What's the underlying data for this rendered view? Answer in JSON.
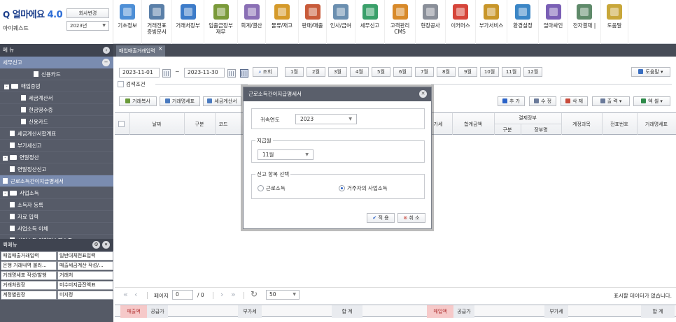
{
  "brand": {
    "logo": "얼마에요",
    "version": "4.0",
    "company": "아이퀘스트",
    "company_change": "회사변경",
    "year": "2023년"
  },
  "menu": [
    {
      "label": "기초정보",
      "color": "#4e8fd6"
    },
    {
      "label": "거래전표\n증빙문서",
      "color": "#5a7fa8"
    },
    {
      "label": "거래처장부",
      "color": "#3d7cc9"
    },
    {
      "label": "입출금장부\n재무",
      "color": "#7a9a3a"
    },
    {
      "label": "회계/결산",
      "color": "#8a6fb5"
    },
    {
      "label": "물류/재고",
      "color": "#d59a2a"
    },
    {
      "label": "판매/매출",
      "color": "#c85b3a"
    },
    {
      "label": "인사/급여",
      "color": "#6b8fb0"
    },
    {
      "label": "세무신고",
      "color": "#3aa06a"
    },
    {
      "label": "고객관리\nCMS",
      "color": "#d88a2a"
    },
    {
      "label": "현장공사",
      "color": "#8a8f99"
    },
    {
      "label": "이커머스",
      "color": "#d6453a"
    },
    {
      "label": "부가서비스",
      "color": "#c8962a"
    },
    {
      "label": "환경설정",
      "color": "#3b86c6"
    },
    {
      "label": "얼마싸인",
      "color": "#7a5fb5"
    },
    {
      "label": "전자결재 |",
      "color": "#5f8a6a"
    },
    {
      "label": "도움말",
      "color": "#c8a73a"
    }
  ],
  "sidebar": {
    "menu_title": "메 뉴",
    "section": "세무신고",
    "items": [
      {
        "label": "신용카드",
        "indent": 48,
        "kind": "file",
        "active": false
      },
      {
        "label": "매입증빙",
        "indent": 6,
        "kind": "folder",
        "toggle": "-",
        "active": false
      },
      {
        "label": "세금계산서",
        "indent": 30,
        "kind": "file",
        "active": false
      },
      {
        "label": "현금영수증",
        "indent": 30,
        "kind": "file",
        "active": false
      },
      {
        "label": "신용카드",
        "indent": 30,
        "kind": "file",
        "active": false
      },
      {
        "label": "세금계산서합계표",
        "indent": 14,
        "kind": "file",
        "active": false
      },
      {
        "label": "부가세신고",
        "indent": 14,
        "kind": "file",
        "active": false
      },
      {
        "label": "연말정산",
        "indent": 4,
        "kind": "folder",
        "toggle": "-",
        "active": false
      },
      {
        "label": "연말정산신고",
        "indent": 14,
        "kind": "file",
        "active": false
      },
      {
        "label": "근로소득간이지급명세서",
        "indent": 4,
        "kind": "file",
        "active": true
      },
      {
        "label": "사업소득",
        "indent": 4,
        "kind": "folder",
        "toggle": "-",
        "active": false
      },
      {
        "label": "소득자 등록",
        "indent": 14,
        "kind": "file",
        "active": false
      },
      {
        "label": "자료 입력",
        "indent": 14,
        "kind": "file",
        "active": false
      },
      {
        "label": "사업소득 이체",
        "indent": 14,
        "kind": "file",
        "active": false
      },
      {
        "label": "사업소득 원천징수영수증",
        "indent": 14,
        "kind": "file",
        "active": false
      }
    ],
    "fav_title": "퀵메뉴",
    "favorites": [
      "매입매출거래입력",
      "일반대체전표입력",
      "은행 거래내역 불러...",
      "매출세금계산 작성/...",
      "거래명세표 작성/발행",
      "거래처",
      "거래처원장",
      "미수미지급잔액표",
      "계정별원장",
      "미지정"
    ]
  },
  "tab": {
    "label": "매입매출거래입력",
    "close": "×"
  },
  "filter": {
    "date_from": "2023-11-01",
    "tilde": "~",
    "date_to": "2023-11-30",
    "search": "조회",
    "months": [
      "1월",
      "2월",
      "3월",
      "4월",
      "5월",
      "6월",
      "7월",
      "8월",
      "9월",
      "10월",
      "11월",
      "12월"
    ],
    "help": "도움말",
    "search_condition": "검색조건"
  },
  "toolbar": {
    "copy": "거래복사",
    "statement": "거래명세표",
    "tax_invoice": "세금계산서",
    "add": "추 가",
    "edit": "수 정",
    "delete": "삭 제",
    "print": "출 력",
    "excel": "엑 셀"
  },
  "grid": {
    "headers": {
      "date": "날짜",
      "type": "구분",
      "code": "코드",
      "vat": "가세",
      "total": "합계금액",
      "settle": "결제장부",
      "settle_type": "구분",
      "settle_book": "장부명",
      "account": "계정과목",
      "voucher": "전표번호",
      "item": "거래명세표"
    }
  },
  "pager": {
    "page_label": "페이지",
    "page": "0",
    "of": "/ 0",
    "page_size": "50",
    "empty": "표시할 데이터가 없습니다."
  },
  "summary": {
    "sales": "매출액",
    "supply1": "공급가",
    "vat1": "부가세",
    "total1": "합 계",
    "purchase": "매입액",
    "supply2": "공급가",
    "vat2": "부가세",
    "total2": "합 계"
  },
  "dialog": {
    "title": "근로소득간이지급명세서",
    "year_label": "귀속연도",
    "year": "2023",
    "month_legend": "지급월",
    "month": "11월",
    "select_legend": "신고 항목 선택",
    "opt1": "근로소득",
    "opt2": "거주자의 사업소득",
    "selected": "opt2",
    "apply": "적 용",
    "cancel": "취 소"
  }
}
